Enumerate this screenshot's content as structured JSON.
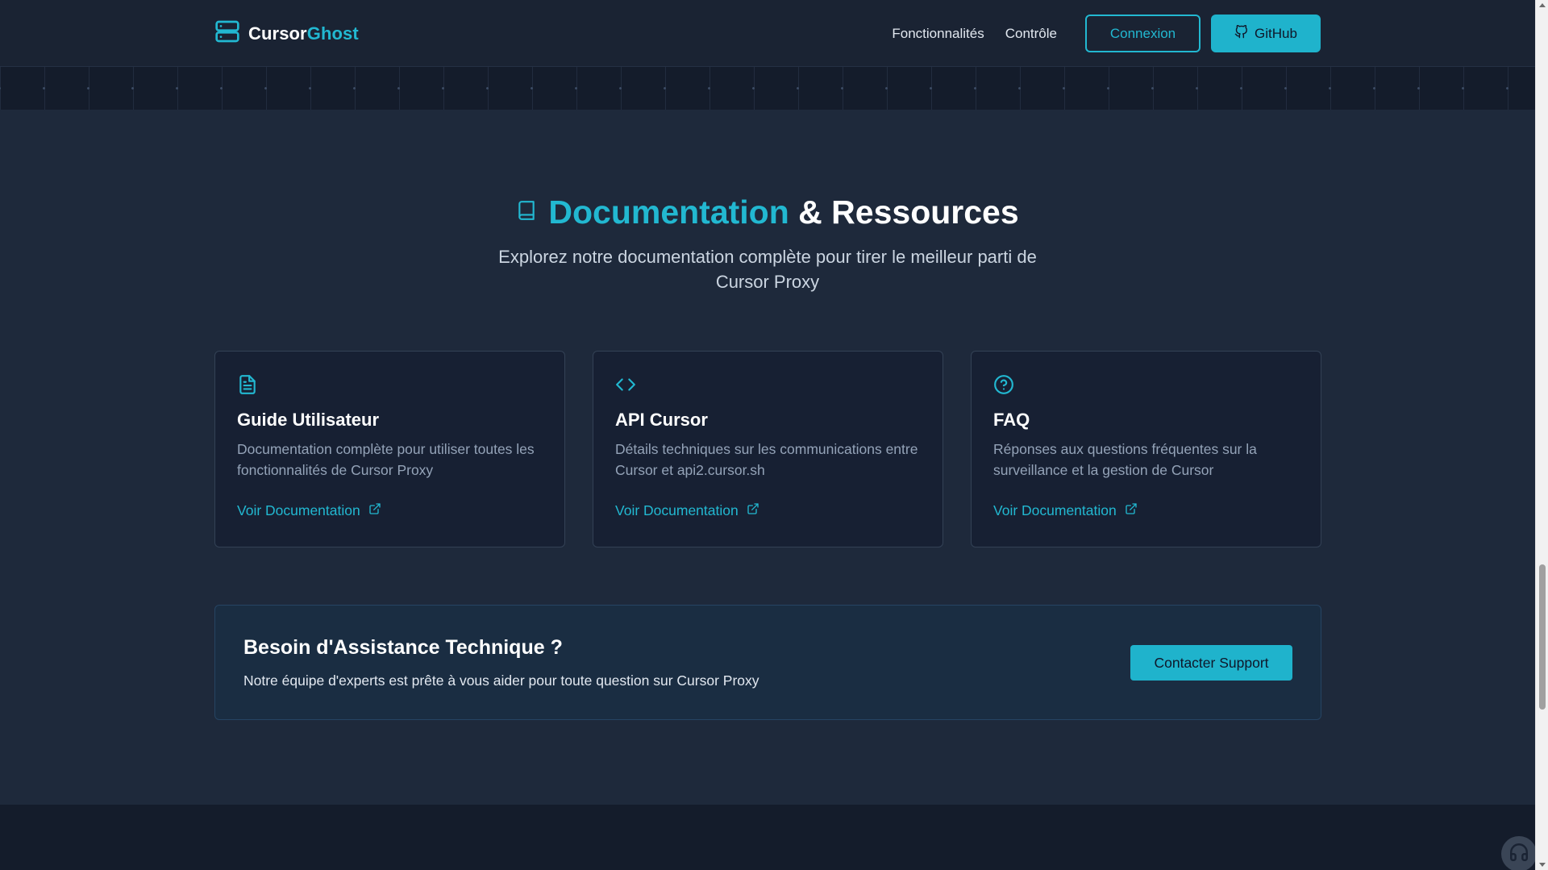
{
  "header": {
    "brand_main": "Cursor",
    "brand_accent": "Ghost",
    "nav": [
      "Fonctionnalités",
      "Contrôle"
    ],
    "login_label": "Connexion",
    "github_label": "GitHub"
  },
  "section": {
    "title_accent": "Documentation",
    "title_rest": "& Ressources",
    "subtitle": "Explorez notre documentation complète pour tirer le meilleur parti de Cursor Proxy",
    "cards": [
      {
        "icon": "file-text-icon",
        "title": "Guide Utilisateur",
        "description": "Documentation complète pour utiliser toutes les fonctionnalités de Cursor Proxy",
        "link": "Voir Documentation"
      },
      {
        "icon": "code-icon",
        "title": "API Cursor",
        "description": "Détails techniques sur les communications entre Cursor et api2.cursor.sh",
        "link": "Voir Documentation"
      },
      {
        "icon": "help-circle-icon",
        "title": "FAQ",
        "description": "Réponses aux questions fréquentes sur la surveillance et la gestion de Cursor",
        "link": "Voir Documentation"
      }
    ]
  },
  "support": {
    "title": "Besoin d'Assistance Technique ?",
    "description": "Notre équipe d'experts est prête à vous aider pour toute question sur Cursor Proxy",
    "button": "Contacter Support"
  },
  "colors": {
    "accent": "#22b8d1",
    "background": "#1e293b",
    "header": "#1a2333",
    "card": "#172033"
  }
}
